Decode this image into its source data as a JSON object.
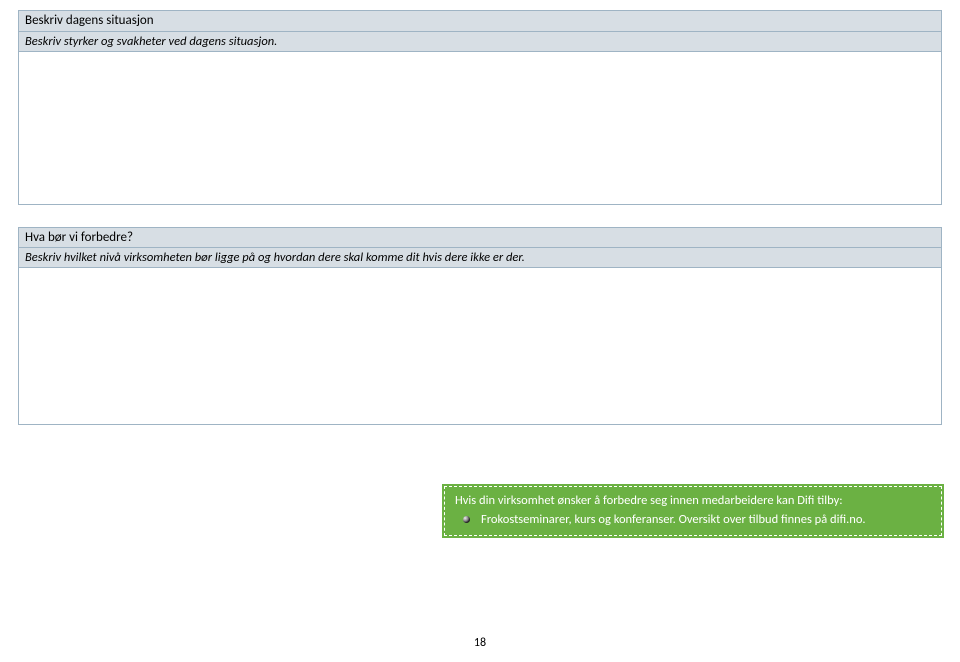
{
  "section1": {
    "title": "Beskriv dagens situasjon",
    "subtitle": "Beskriv styrker og svakheter ved dagens situasjon."
  },
  "section2": {
    "title": "Hva bør vi forbedre?",
    "subtitle": "Beskriv hvilket nivå virksomheten bør ligge på og hvordan dere skal komme dit hvis dere ikke er der."
  },
  "callout": {
    "intro": "Hvis din virksomhet ønsker å forbedre seg innen medarbeidere kan Difi tilby:",
    "item": "Frokostseminarer, kurs og konferanser. Oversikt over tilbud finnes på difi.no."
  },
  "pageNumber": "18"
}
